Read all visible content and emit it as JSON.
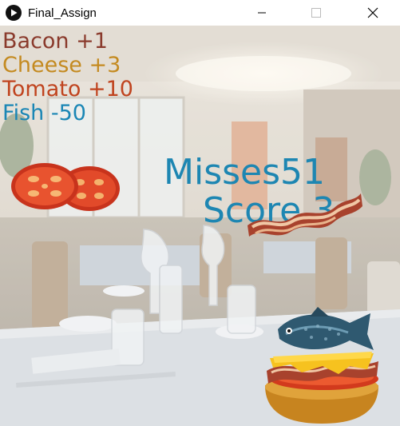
{
  "window": {
    "title": "Final_Assign",
    "icon": "processing-play-icon"
  },
  "legend": {
    "bacon": "Bacon +1",
    "cheese": "Cheese +3",
    "tomato": "Tomato +10",
    "fish": "Fish -50"
  },
  "hud": {
    "misses_text": "Misses51",
    "score_text": "Score 3"
  },
  "colors": {
    "bacon": "#8a3a2c",
    "cheese": "#c48a20",
    "tomato": "#c0441f",
    "fish": "#1a86b5",
    "hud": "#1d86b2"
  }
}
